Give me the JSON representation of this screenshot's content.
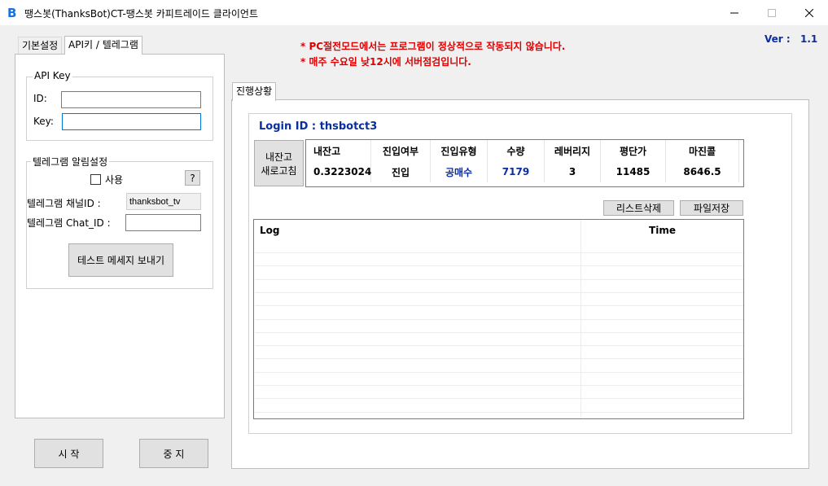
{
  "window": {
    "title": "땡스봇(ThanksBot)CT-땡스봇 카피트레이드 클라이언트",
    "icon": "thanksbot-logo-icon"
  },
  "left_tabs": [
    {
      "label": "기본설정",
      "active": false
    },
    {
      "label": "API키 / 텔레그램",
      "active": true
    }
  ],
  "api_key": {
    "legend": "API Key",
    "id_label": "ID:",
    "id_value": "",
    "key_label": "Key:",
    "key_value": ""
  },
  "telegram": {
    "legend": "텔레그램 알림설정",
    "use_label": "사용",
    "use_checked": false,
    "help_label": "?",
    "channel_label": "텔레그램  채널ID :",
    "channel_value": "thanksbot_tv",
    "chat_label": "텔레그램  Chat_ID :",
    "chat_value": "",
    "test_button": "테스트 메세지 보내기"
  },
  "controls": {
    "start": "시 작",
    "stop": "중 지"
  },
  "notices": [
    "* PC절전모드에서는 프로그램이 정상적으로 작동되지 않습니다.",
    "* 매주 수요일 낮12시에 서버점검입니다."
  ],
  "version": {
    "label": "Ver :",
    "value": "1.1"
  },
  "right_tab": {
    "label": "진행상황"
  },
  "login": {
    "text": "Login ID : thsbotct3"
  },
  "refresh_button": {
    "line1": "내잔고",
    "line2": "새로고침"
  },
  "stats": {
    "headers": [
      "내잔고",
      "진입여부",
      "진입유형",
      "수량",
      "레버리지",
      "평단가",
      "마진콜"
    ],
    "values": [
      "0.3223024",
      "진입",
      "공매수",
      "7179",
      "3",
      "11485",
      "8646.5"
    ]
  },
  "list_buttons": {
    "delete": "리스트삭제",
    "save": "파일저장"
  },
  "log": {
    "col_log": "Log",
    "col_time": "Time",
    "rows": 13
  },
  "colors": {
    "accent_blue": "#0a2ea0",
    "notice_red": "#e00000",
    "window_bg": "#f0f0f0"
  }
}
